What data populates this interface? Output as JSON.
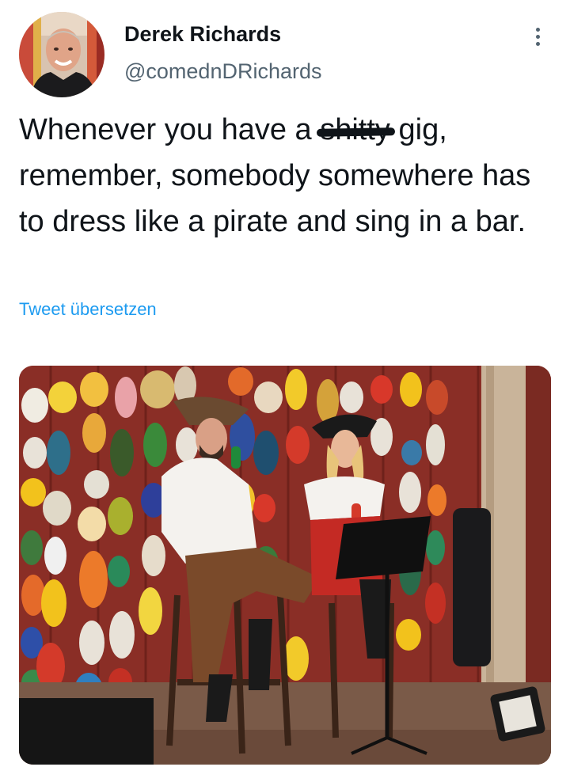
{
  "author": {
    "display_name": "Derek Richards",
    "handle": "@comednDRichards",
    "avatar_icon": "person-avatar"
  },
  "menu": {
    "icon": "more-vertical-icon"
  },
  "tweet": {
    "text_before": "Whenever you have a ",
    "struck_word": "shitty",
    "text_after": " gig, remember, somebody somewhere has to dress like a pirate and sing in a bar."
  },
  "translate": {
    "label": "Tweet übersetzen"
  },
  "colors": {
    "text": "#0f1419",
    "secondary_text": "#536471",
    "link": "#1d9bf0"
  }
}
